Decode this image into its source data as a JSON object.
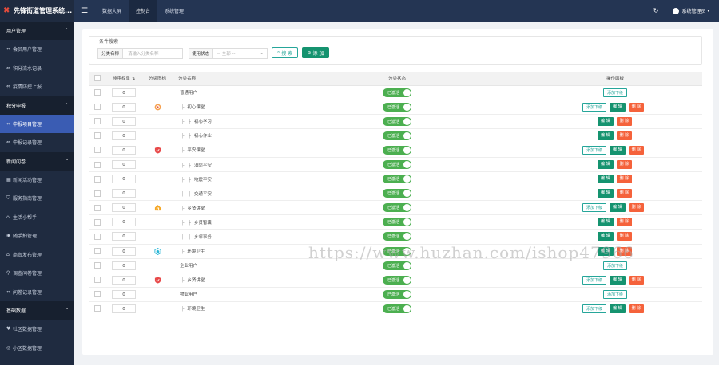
{
  "app": {
    "title": "先锋街道管理系统..."
  },
  "sidebar": {
    "items": [
      {
        "type": "group",
        "label": "用户管理",
        "icon": "chevron-up-icon"
      },
      {
        "type": "item",
        "label": "会员用户管理",
        "icon": "link-icon"
      },
      {
        "type": "item",
        "label": "积分流水记录",
        "icon": "link-icon"
      },
      {
        "type": "item",
        "label": "疫情防控上报",
        "icon": "link-icon"
      },
      {
        "type": "group",
        "label": "积分申报",
        "icon": "chevron-up-icon"
      },
      {
        "type": "item",
        "label": "申报项目管理",
        "icon": "link-icon",
        "active": true
      },
      {
        "type": "item",
        "label": "申报记录管理",
        "icon": "link-icon"
      },
      {
        "type": "group",
        "label": "新闻问卷",
        "icon": "chevron-up-icon"
      },
      {
        "type": "item",
        "label": "新闻活动管理",
        "icon": "grid-icon"
      },
      {
        "type": "item",
        "label": "服务指南管理",
        "icon": "shield-icon"
      },
      {
        "type": "item",
        "label": "生活小帮手",
        "icon": "store-icon"
      },
      {
        "type": "item",
        "label": "随手拍管理",
        "icon": "camera-icon"
      },
      {
        "type": "item",
        "label": "商贸发布管理",
        "icon": "store-icon"
      },
      {
        "type": "item",
        "label": "调查问卷管理",
        "icon": "pin-icon"
      },
      {
        "type": "item",
        "label": "问卷记录管理",
        "icon": "link-icon"
      },
      {
        "type": "group",
        "label": "基础数据",
        "icon": "chevron-up-icon"
      },
      {
        "type": "item",
        "label": "社区数据管理",
        "icon": "heart-icon"
      },
      {
        "type": "item",
        "label": "小区数据管理",
        "icon": "globe-icon"
      }
    ]
  },
  "topbar": {
    "tabs": [
      {
        "label": "数据大屏",
        "active": false
      },
      {
        "label": "控制台",
        "active": true
      },
      {
        "label": "系统管理",
        "active": false
      }
    ],
    "user": "系统管理员"
  },
  "search": {
    "title": "条件搜索",
    "name_label": "分类名称",
    "name_placeholder": "请输入分类名称",
    "status_label": "使用状态",
    "status_value": "-- 全部 --",
    "search_button": "搜 索",
    "add_button": "添 加"
  },
  "table": {
    "headers": {
      "sort": "排序权重",
      "icon": "分类图标",
      "name": "分类名称",
      "status": "分类状态",
      "ops": "操作面板"
    },
    "status_text": "已激活",
    "ops": {
      "add_sub": "添加下级",
      "edit": "编 辑",
      "delete": "删 除"
    },
    "rows": [
      {
        "sort": "0",
        "prefix": "",
        "name": "普通用户",
        "icon": "",
        "add": true,
        "edit": false,
        "del": false
      },
      {
        "sort": "0",
        "prefix": "├",
        "name": "初心课堂",
        "icon": "target-icon",
        "add": true,
        "edit": true,
        "del": true
      },
      {
        "sort": "0",
        "prefix": "├   ├",
        "name": "初心学习",
        "icon": "",
        "add": false,
        "edit": true,
        "del": true
      },
      {
        "sort": "0",
        "prefix": "├   ├",
        "name": "初心作业",
        "icon": "",
        "add": false,
        "edit": true,
        "del": true
      },
      {
        "sort": "0",
        "prefix": "├",
        "name": "平安课堂",
        "icon": "shield-badge-icon",
        "add": true,
        "edit": true,
        "del": true
      },
      {
        "sort": "0",
        "prefix": "├   ├",
        "name": "消防平安",
        "icon": "",
        "add": false,
        "edit": true,
        "del": true
      },
      {
        "sort": "0",
        "prefix": "├   ├",
        "name": "地震平安",
        "icon": "",
        "add": false,
        "edit": true,
        "del": true
      },
      {
        "sort": "0",
        "prefix": "├   ├",
        "name": "交通平安",
        "icon": "",
        "add": false,
        "edit": true,
        "del": true
      },
      {
        "sort": "0",
        "prefix": "├",
        "name": "乡贤讲堂",
        "icon": "house-icon",
        "add": true,
        "edit": true,
        "del": true
      },
      {
        "sort": "0",
        "prefix": "├   ├",
        "name": "乡贤智囊",
        "icon": "",
        "add": false,
        "edit": true,
        "del": true
      },
      {
        "sort": "0",
        "prefix": "├   ├",
        "name": "乡邻事务",
        "icon": "",
        "add": false,
        "edit": true,
        "del": true
      },
      {
        "sort": "0",
        "prefix": "├",
        "name": "环境卫生",
        "icon": "hexagon-icon",
        "add": false,
        "edit": true,
        "del": true
      },
      {
        "sort": "0",
        "prefix": "",
        "name": "企业用户",
        "icon": "",
        "add": true,
        "edit": false,
        "del": false
      },
      {
        "sort": "0",
        "prefix": "├",
        "name": "乡贤讲堂",
        "icon": "shield-badge-icon",
        "add": true,
        "edit": true,
        "del": true
      },
      {
        "sort": "0",
        "prefix": "",
        "name": "物业用户",
        "icon": "",
        "add": true,
        "edit": false,
        "del": false
      },
      {
        "sort": "0",
        "prefix": "├",
        "name": "环境卫生",
        "icon": "",
        "add": true,
        "edit": true,
        "del": true
      }
    ]
  },
  "watermark": "https://www.huzhan.com/ishop47966",
  "colors": {
    "sidebar": "#1f2b40",
    "topbar": "#243553",
    "active": "#3a5cb3",
    "green": "#4caf50",
    "edit": "#15936f",
    "delete": "#f5623b"
  }
}
